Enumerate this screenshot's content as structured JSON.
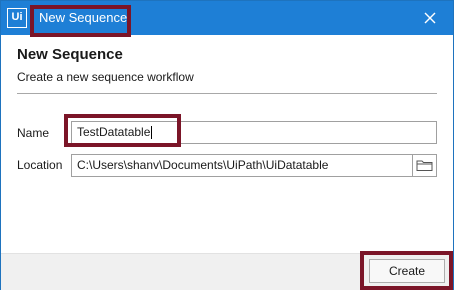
{
  "titlebar": {
    "app_icon": "Ui",
    "title": "New Sequence",
    "close_icon": "close-icon"
  },
  "dialog": {
    "heading": "New Sequence",
    "subtitle": "Create a new sequence workflow"
  },
  "form": {
    "name_label": "Name",
    "name_value": "TestDatatable",
    "location_label": "Location",
    "location_value": "C:\\Users\\shanv\\Documents\\UiPath\\UiDatatable",
    "browse_icon": "folder-icon"
  },
  "footer": {
    "create_label": "Create"
  },
  "colors": {
    "titlebar": "#1e7fd6",
    "highlight": "#7b1528",
    "footer": "#f0f0f0"
  }
}
